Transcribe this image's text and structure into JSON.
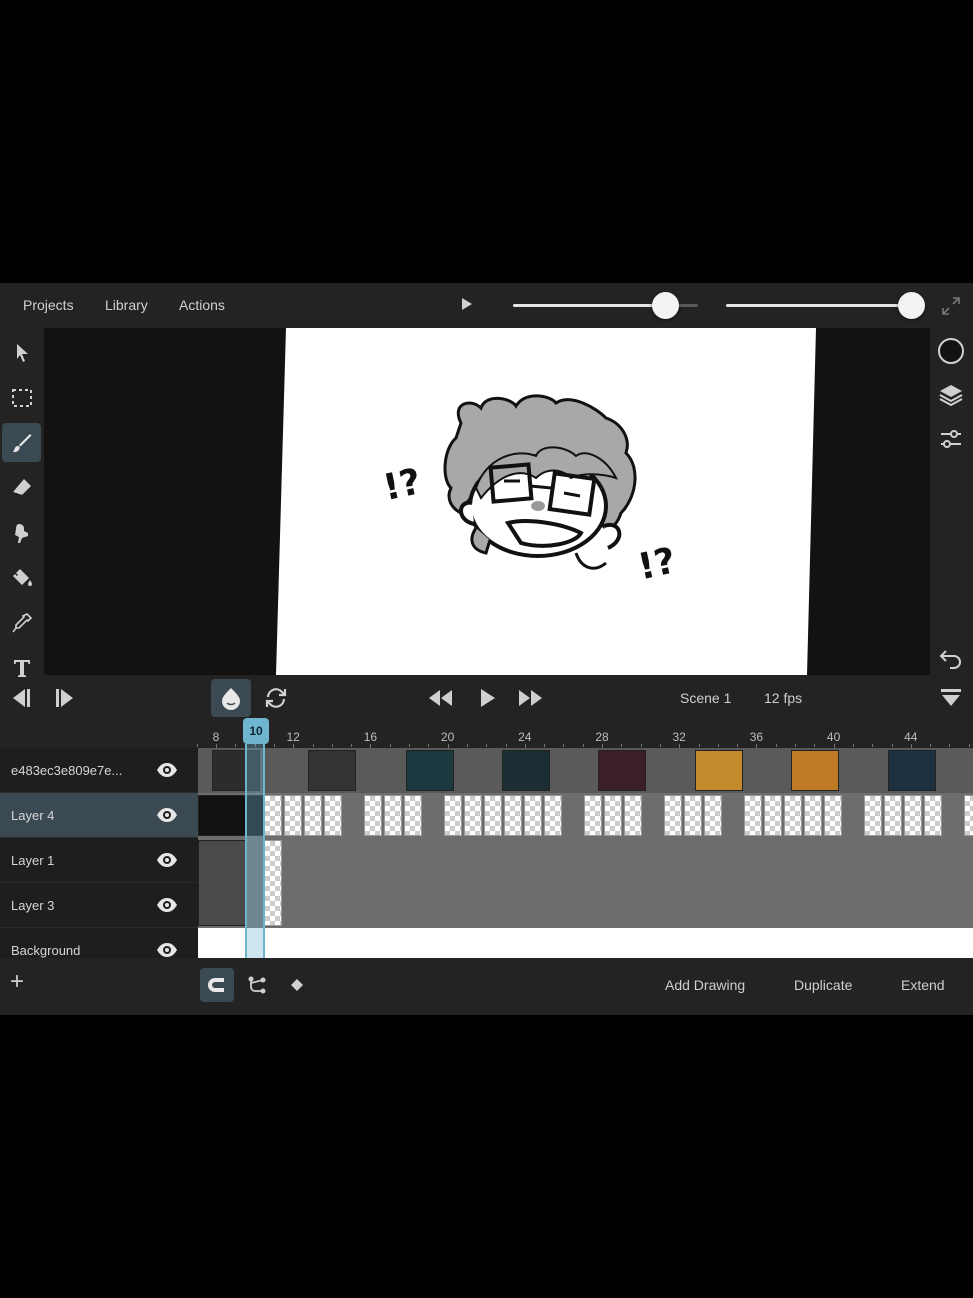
{
  "menu": {
    "projects": "Projects",
    "library": "Library",
    "actions": "Actions"
  },
  "sliders": {
    "brush_size": 0.82,
    "opacity": 1.0
  },
  "canvas": {
    "drawing_text_left": "!?",
    "drawing_text_right": "!?"
  },
  "transport": {
    "scene": "Scene 1",
    "fps": "12 fps"
  },
  "timeline": {
    "current_frame": "10",
    "ruler_labels": [
      "8",
      "12",
      "16",
      "20",
      "24",
      "28",
      "32",
      "36",
      "40",
      "44"
    ]
  },
  "layers": [
    {
      "name": "e483ec3e809e7e...",
      "active": false
    },
    {
      "name": "Layer 4",
      "active": true
    },
    {
      "name": "Layer 1",
      "active": false
    },
    {
      "name": "Layer 3",
      "active": false
    },
    {
      "name": "Background",
      "active": false
    }
  ],
  "bottom": {
    "add_layer": "+",
    "add_drawing": "Add Drawing",
    "duplicate": "Duplicate",
    "extend": "Extend"
  },
  "icons": {
    "left_tools": [
      "select-arrow-icon",
      "marquee-select-icon",
      "brush-icon",
      "eraser-icon",
      "smudge-icon",
      "fill-bucket-icon",
      "eyedropper-icon",
      "text-icon"
    ],
    "right_tools": [
      "color-circle-icon",
      "layers-icon",
      "adjust-sliders-icon",
      "undo-icon",
      "timeline-collapse-icon"
    ]
  },
  "colors": {
    "accent": "#6fb5cf",
    "active_bg": "#3b4a52",
    "panel": "#232323"
  }
}
